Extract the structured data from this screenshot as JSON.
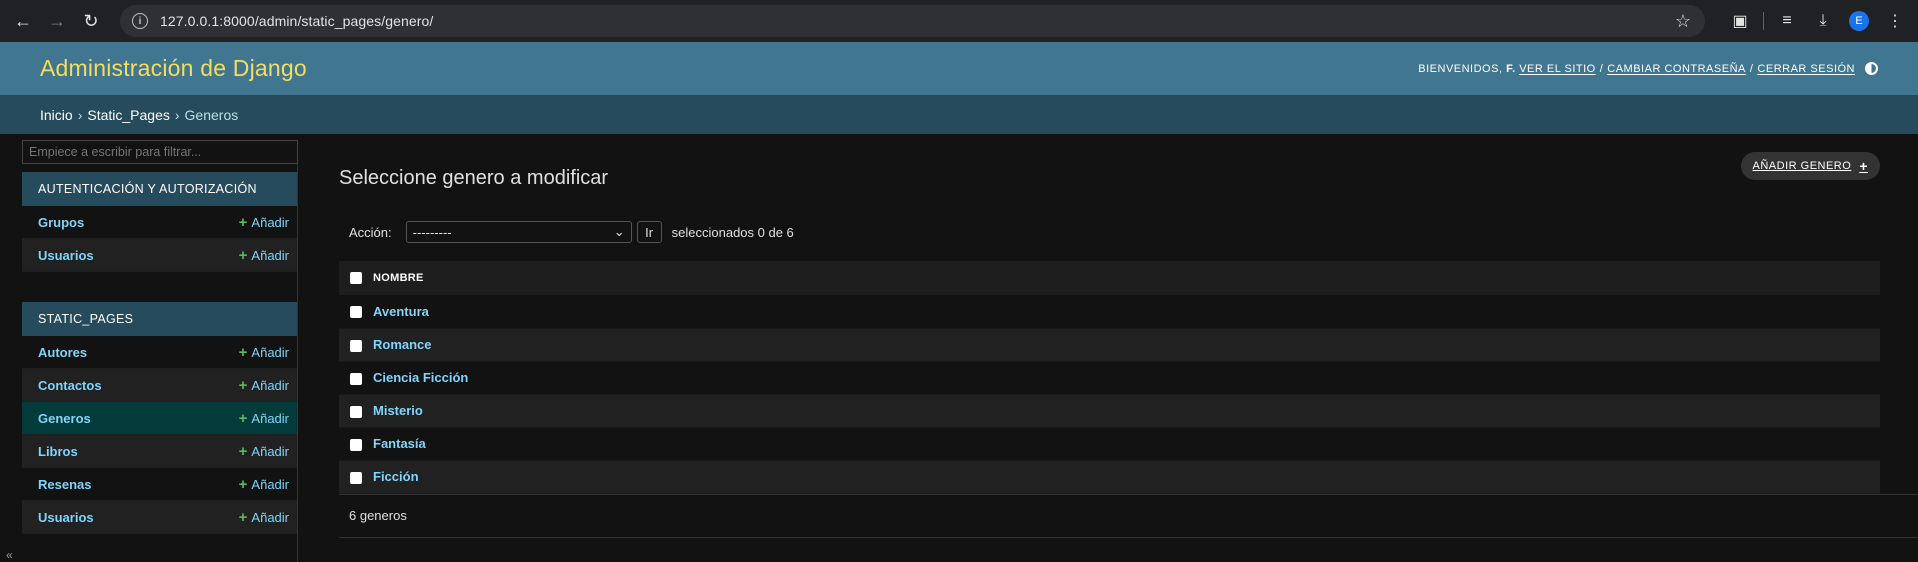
{
  "browser": {
    "url": "127.0.0.1:8000/admin/static_pages/genero/",
    "avatar_letter": "E"
  },
  "header": {
    "branding": "Administración de Django",
    "welcome": "BIENVENIDOS,",
    "user": "F.",
    "view_site": "VER EL SITIO",
    "change_password": "CAMBIAR CONTRASEÑA",
    "logout": "CERRAR SESIÓN",
    "separator": "/"
  },
  "breadcrumbs": {
    "home": "Inicio",
    "app": "Static_Pages",
    "current": "Generos",
    "separator": "›"
  },
  "sidebar": {
    "filter_placeholder": "Empiece a escribir para filtrar...",
    "add_label": "Añadir",
    "modules": [
      {
        "caption": "Autenticación y autorización",
        "models": [
          "Grupos",
          "Usuarios"
        ]
      },
      {
        "caption": "Static_Pages",
        "models": [
          "Autores",
          "Contactos",
          "Generos",
          "Libros",
          "Resenas",
          "Usuarios"
        ]
      }
    ]
  },
  "content": {
    "title": "Seleccione genero a modificar",
    "add_button": "AÑADIR GENERO",
    "action_label": "Acción:",
    "action_selected": "---------",
    "go_button": "Ir",
    "action_counter": "seleccionados 0 de 6",
    "column_header": "NOMBRE",
    "rows": [
      "Aventura",
      "Romance",
      "Ciencia Ficción",
      "Misterio",
      "Fantasía",
      "Ficción"
    ],
    "paginator": "6 generos"
  },
  "colors": {
    "header_bg": "#417690",
    "breadcrumbs_bg": "#264b5d",
    "branding": "#f5dd5d",
    "link": "#81d4fa",
    "current_row": "#033a3a",
    "add_plus": "#5db85c"
  }
}
